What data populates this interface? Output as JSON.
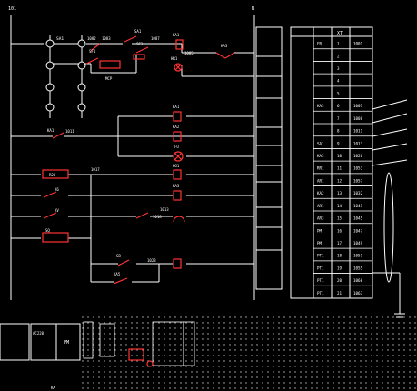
{
  "colors": {
    "background": "#000000",
    "wire": "#ffffff",
    "device": "#ff3333",
    "terminal_box": "#ffffff",
    "dot_grid": "#bdbdbd"
  },
  "bus": {
    "left_label": "101",
    "right_label": "N"
  },
  "devices": {
    "SA1": "SA1",
    "S1": "SF1",
    "S2": "SA1",
    "S3": "SF1",
    "KA1": "KA1",
    "KA2": "KA2",
    "KA3": "KA3",
    "HR1": "HR1",
    "HG1": "HG1",
    "MCP": "MCP",
    "KA_coil": "KA1",
    "R20": "R20",
    "K6": "K6",
    "KV": "KV",
    "SQ": "SQ",
    "FU": "FU",
    "SB": "SB",
    "KAx": "KA5"
  },
  "wire_labels": {
    "w1": "1082",
    "w2": "1083",
    "w3": "1087",
    "w4": "1085",
    "w5": "1017",
    "w6": "1018",
    "w7": "1023",
    "w8": "1011",
    "w9": "1013"
  },
  "terminal_header": "XT",
  "terminal_rows": [
    {
      "dev": "FR",
      "num": "1",
      "wire": "1001"
    },
    {
      "dev": "",
      "num": "2",
      "wire": ""
    },
    {
      "dev": "",
      "num": "3",
      "wire": ""
    },
    {
      "dev": "",
      "num": "4",
      "wire": ""
    },
    {
      "dev": "",
      "num": "5",
      "wire": ""
    },
    {
      "dev": "KA3",
      "num": "6",
      "wire": "1007"
    },
    {
      "dev": "",
      "num": "7",
      "wire": "1008"
    },
    {
      "dev": "",
      "num": "8",
      "wire": "1011"
    },
    {
      "dev": "SA1",
      "num": "9",
      "wire": "1013"
    },
    {
      "dev": "KA3",
      "num": "10",
      "wire": "1026"
    },
    {
      "dev": "RR1",
      "num": "11",
      "wire": "1053"
    },
    {
      "dev": "AR1",
      "num": "12",
      "wire": "1057"
    },
    {
      "dev": "KA2",
      "num": "13",
      "wire": "1032"
    },
    {
      "dev": "AR1",
      "num": "14",
      "wire": "1041"
    },
    {
      "dev": "AR3",
      "num": "15",
      "wire": "1045"
    },
    {
      "dev": "PM",
      "num": "16",
      "wire": "1047"
    },
    {
      "dev": "PM",
      "num": "17",
      "wire": "1049"
    },
    {
      "dev": "PT1",
      "num": "18",
      "wire": "1051"
    },
    {
      "dev": "PT1",
      "num": "19",
      "wire": "1055"
    },
    {
      "dev": "PT1",
      "num": "20",
      "wire": "1060"
    },
    {
      "dev": "PT1",
      "num": "21",
      "wire": "1063"
    }
  ],
  "bottom": {
    "panel1_label": "PM",
    "panel1_sub": "AC220",
    "panel2_label": "KA",
    "panel3_label": "PM"
  }
}
